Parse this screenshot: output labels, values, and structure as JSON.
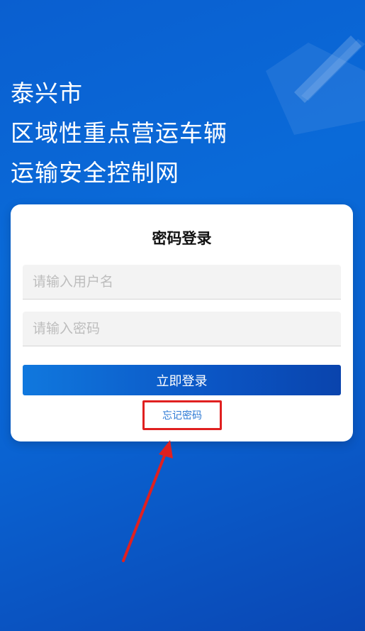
{
  "header": {
    "title_lines": [
      "泰兴市",
      "区域性重点营运车辆",
      "运输安全控制网"
    ]
  },
  "login": {
    "title": "密码登录",
    "username_placeholder": "请输入用户名",
    "password_placeholder": "请输入密码",
    "submit_label": "立即登录",
    "forgot_label": "忘记密码"
  },
  "colors": {
    "background": "#0a63d2",
    "button": "#0b55c4",
    "link": "#2b78d4",
    "annotation": "#e02020"
  }
}
